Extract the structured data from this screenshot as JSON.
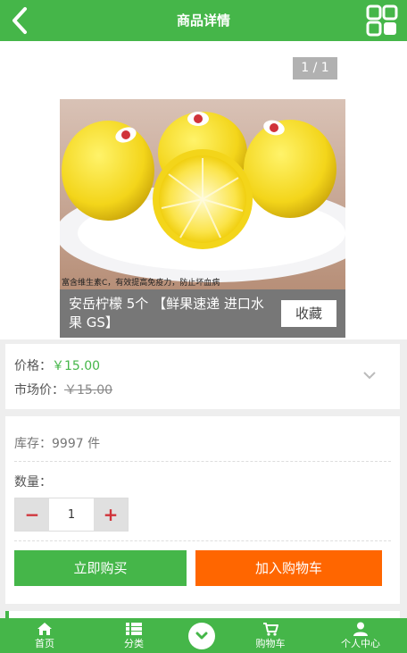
{
  "header": {
    "title": "商品详情",
    "back_icon": "chevron-left-icon",
    "menu_icon": "grid-icon"
  },
  "gallery": {
    "pager": "1 / 1",
    "image_caption": "富含维生素C，有效提高免疫力，防止坏血病",
    "product_name": "安岳柠檬 5个 【鲜果速递 进口水果 GS】",
    "favorite_label": "收藏"
  },
  "price": {
    "price_label": "价格：",
    "price_value": "￥15.00",
    "market_label": "市场价：",
    "market_value": "￥15.00"
  },
  "stock": {
    "stock_text": "库存：9997 件",
    "quantity_label": "数量：",
    "quantity_value": "1",
    "minus_symbol": "−",
    "plus_symbol": "+",
    "buy_now_label": "立即购买",
    "add_to_cart_label": "加入购物车"
  },
  "tabbar": {
    "items": [
      {
        "label": "首页",
        "icon": "home-icon"
      },
      {
        "label": "分类",
        "icon": "list-icon"
      },
      {
        "label": "",
        "icon": "chevron-circle-icon"
      },
      {
        "label": "购物车",
        "icon": "cart-icon"
      },
      {
        "label": "个人中心",
        "icon": "user-icon"
      }
    ]
  },
  "colors": {
    "primary_green": "#45b649",
    "cart_orange": "#ff6600",
    "stepper_red": "#d0333a"
  }
}
